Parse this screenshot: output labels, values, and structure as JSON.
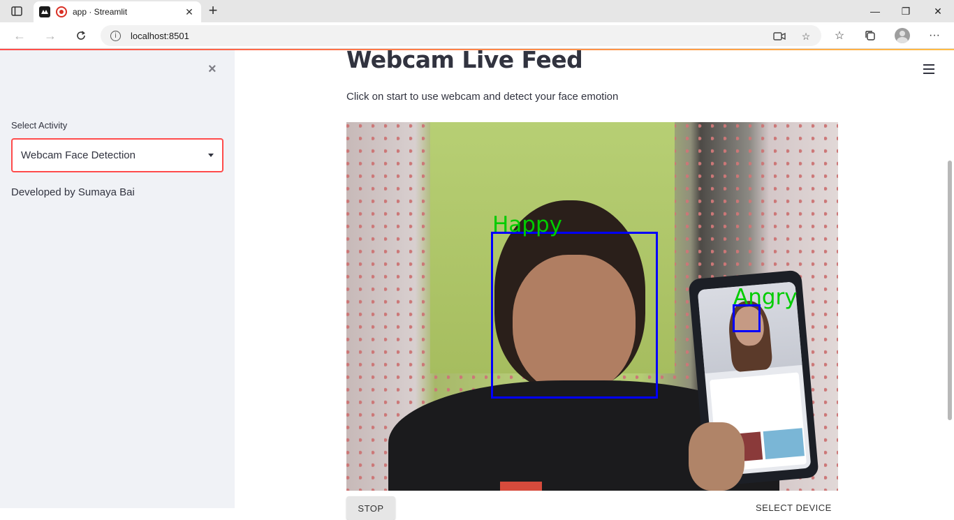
{
  "browser": {
    "tab_title": "app · Streamlit",
    "new_tab_symbol": "+",
    "url": "localhost:8501",
    "window_controls": {
      "minimize": "—",
      "maximize": "❐",
      "close": "✕"
    }
  },
  "sidebar": {
    "close_symbol": "×",
    "select_label": "Select Activity",
    "select_value": "Webcam Face Detection",
    "developer_text": "Developed by Sumaya Bai"
  },
  "main": {
    "title": "Webcam Live Feed",
    "subtitle": "Click on start to use webcam and detect your face emotion",
    "detections": [
      {
        "label": "Happy"
      },
      {
        "label": "Angry"
      }
    ],
    "stop_button": "STOP",
    "select_device": "SELECT DEVICE"
  },
  "colors": {
    "accent": "#ff4b4b",
    "detection_box": "#0000ff",
    "detection_label": "#00cc00",
    "sidebar_bg": "#f0f2f6",
    "text": "#31333f"
  },
  "icons": [
    "sidebar-toggle-icon",
    "streamlit-favicon-icon",
    "recording-icon",
    "close-tab-icon",
    "back-icon",
    "forward-icon",
    "reload-icon",
    "info-icon",
    "camera-icon",
    "add-favorite-icon",
    "favorites-icon",
    "collections-icon",
    "profile-icon",
    "more-icon",
    "hamburger-menu-icon",
    "dropdown-caret-icon"
  ]
}
